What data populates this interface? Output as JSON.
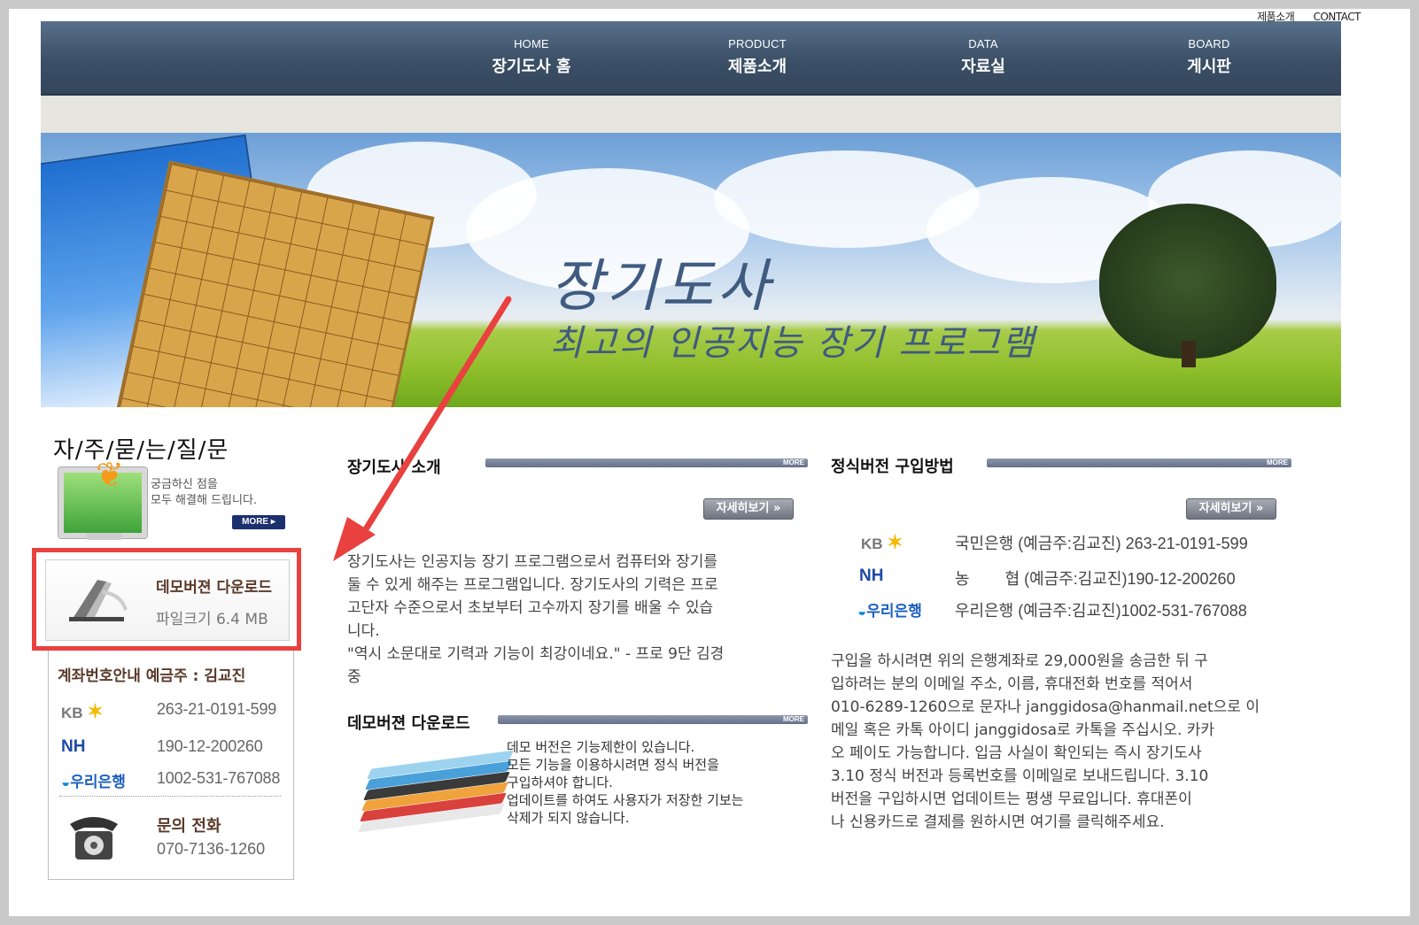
{
  "util_links": [
    "제품소개",
    "CONTACT"
  ],
  "nav": [
    {
      "en": "HOME",
      "ko": "장기도사 홈"
    },
    {
      "en": "PRODUCT",
      "ko": "제품소개"
    },
    {
      "en": "DATA",
      "ko": "자료실"
    },
    {
      "en": "BOARD",
      "ko": "게시판"
    }
  ],
  "banner": {
    "title": "장기도사",
    "subtitle": "최고의 인공지능 장기 프로그램"
  },
  "faq": {
    "title": "자/주/묻/는/질/문",
    "desc1": "궁금하신 점을",
    "desc2": "모두 해결해 드립니다.",
    "more": "MORE"
  },
  "demo_box": {
    "label": "데모버젼 다운로드",
    "size": "파일크기 6.4 MB"
  },
  "accounts": {
    "title": "계좌번호안내  예금주 : 김교진",
    "kb": {
      "logo": "KB",
      "num": "263-21-0191-599"
    },
    "nh": {
      "logo": "NH",
      "num": "190-12-200260"
    },
    "woori": {
      "logo": "우리은행",
      "num": "1002-531-767088"
    },
    "phone_label": "문의 전화",
    "phone_num": "070-7136-1260"
  },
  "intro": {
    "title": "장기도사 소개",
    "more": "MORE",
    "detail": "자세히보기",
    "lines": [
      "장기도사는 인공지능 장기 프로그램으로서 컴퓨터와 장기를",
      "둘 수 있게 해주는 프로그램입니다. 장기도사의 기력은 프로",
      "고단자 수준으로서 초보부터 고수까지 장기를 배울 수 있습",
      "니다.",
      "\"역시 소문대로 기력과 기능이 최강이네요.\" - 프로 9단 김경",
      "중"
    ]
  },
  "demo": {
    "title": "데모버젼 다운로드",
    "more": "MORE",
    "lines": [
      "데모 버전은 기능제한이 있습니다.",
      "모든 기능을 이용하시려면 정식 버전을",
      "구입하셔야 합니다.",
      "업데이트를 하여도 사용자가 저장한 기보는",
      "삭제가  되지 않습니다."
    ]
  },
  "purchase": {
    "title": "정식버전 구입방법",
    "more": "MORE",
    "detail": "자세히보기",
    "banks": [
      {
        "logo": "KB",
        "text": "국민은행 (예금주:김교진) 263-21-0191-599"
      },
      {
        "logo": "NH",
        "text": "농        협 (예금주:김교진)190-12-200260"
      },
      {
        "logo": "우리은행",
        "text": "우리은행 (예금주:김교진)1002-531-767088"
      }
    ],
    "lines": [
      "구입을 하시려면 위의 은행계좌로 29,000원을 송금한 뒤 구",
      "입하려는 분의 이메일 주소, 이름, 휴대전화 번호를 적어서",
      "010-6289-1260으로 문자나 janggidosa@hanmail.net으로 이",
      "메일 혹은 카톡 아이디 janggidosa로 카톡을 주십시오. 카카",
      "오 페이도 가능합니다. 입금 사실이 확인되는 즉시 장기도사",
      "3.10 정식 버전과 등록번호를 이메일로 보내드립니다. 3.10",
      "버전을 구입하시면 업데이트는 평생 무료입니다. 휴대폰이",
      "나 신용카드로 결제를 원하시면 여기를 클릭해주세요."
    ]
  },
  "colors": {
    "nav": "#3b4f66",
    "highlight": "#e8413f",
    "heading_brown": "#5a3a28"
  }
}
